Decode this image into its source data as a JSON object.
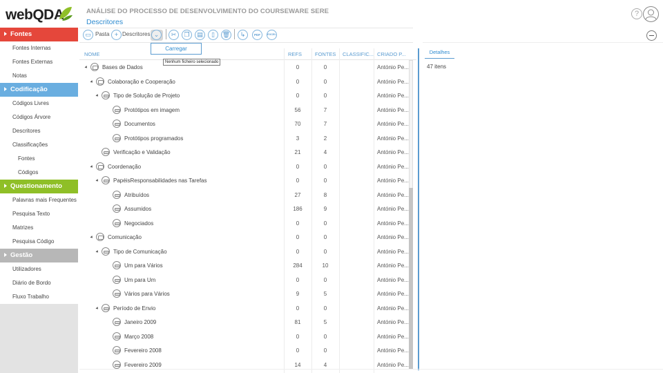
{
  "logo": {
    "text": "webQDA"
  },
  "nav": {
    "sections": [
      {
        "title": "Fontes",
        "color": "#e5473b",
        "items": [
          "Fontes Internas",
          "Fontes Externas",
          "Notas"
        ]
      },
      {
        "title": "Codificação",
        "color": "#6aaee0",
        "items": [
          "Códigos Livres",
          "Códigos Árvore",
          "Descritores",
          "Classificações",
          "Fontes",
          "Códigos"
        ]
      },
      {
        "title": "Questionamento",
        "color": "#8fbf27",
        "items": [
          "Palavras mais Frequentes",
          "Pesquisa Texto",
          "Matrizes",
          "Pesquisa Código"
        ]
      },
      {
        "title": "Gestão",
        "color": "#b7b7b7",
        "items": [
          "Utilizadores",
          "Diário de Bordo",
          "Fluxo Trabalho"
        ]
      }
    ]
  },
  "header": {
    "app_title": "ANÁLISE DO PROCESSO DE DESENVOLVIMENTO DO COURSEWARE SERE",
    "page_title": "Descritores",
    "help": "?"
  },
  "toolbar": {
    "pasta_label": "Pasta",
    "descritores_label": "Descritores",
    "pdf_label": "PDF",
    "excel_label": "EXCEL"
  },
  "dropdown": {
    "option": "Carregar",
    "tooltip": "Nenhum ficheiro selecionado"
  },
  "table": {
    "columns": [
      "NOME",
      "REFS",
      "FONTES",
      "CLASSIFIC...",
      "CRIADO P..."
    ],
    "rows": [
      {
        "name": "Bases de Dados",
        "level": 0,
        "type": "folder",
        "expanded": true,
        "refs": "0",
        "fontes": "0",
        "autor": "António Pe..."
      },
      {
        "name": "Colaboração e Cooperação",
        "level": 1,
        "type": "folder",
        "expanded": true,
        "refs": "0",
        "fontes": "0",
        "autor": "António Pe..."
      },
      {
        "name": "Tipo de Solução de Projeto",
        "level": 2,
        "type": "code",
        "expanded": true,
        "refs": "0",
        "fontes": "0",
        "autor": "António Pe..."
      },
      {
        "name": "Protótipos em imagem",
        "level": 3,
        "type": "code",
        "expanded": false,
        "refs": "56",
        "fontes": "7",
        "autor": "António Pe..."
      },
      {
        "name": "Documentos",
        "level": 3,
        "type": "code",
        "expanded": false,
        "refs": "70",
        "fontes": "7",
        "autor": "António Pe..."
      },
      {
        "name": "Protótipos programados",
        "level": 3,
        "type": "code",
        "expanded": false,
        "refs": "3",
        "fontes": "2",
        "autor": "António Pe..."
      },
      {
        "name": "Verificação e Validação",
        "level": 2,
        "type": "code",
        "expanded": false,
        "refs": "21",
        "fontes": "4",
        "autor": "António Pe..."
      },
      {
        "name": "Coordenação",
        "level": 1,
        "type": "folder",
        "expanded": true,
        "refs": "0",
        "fontes": "0",
        "autor": "António Pe..."
      },
      {
        "name": "PapéisResponsabilidades nas Tarefas",
        "level": 2,
        "type": "code",
        "expanded": true,
        "refs": "0",
        "fontes": "0",
        "autor": "António Pe..."
      },
      {
        "name": "Atribuídos",
        "level": 3,
        "type": "code",
        "expanded": false,
        "refs": "27",
        "fontes": "8",
        "autor": "António Pe..."
      },
      {
        "name": "Assumidos",
        "level": 3,
        "type": "code",
        "expanded": false,
        "refs": "186",
        "fontes": "9",
        "autor": "António Pe..."
      },
      {
        "name": "Negociados",
        "level": 3,
        "type": "code",
        "expanded": false,
        "refs": "0",
        "fontes": "0",
        "autor": "António Pe..."
      },
      {
        "name": "Comunicação",
        "level": 1,
        "type": "folder",
        "expanded": true,
        "refs": "0",
        "fontes": "0",
        "autor": "António Pe..."
      },
      {
        "name": "Tipo de Comunicação",
        "level": 2,
        "type": "code",
        "expanded": true,
        "refs": "0",
        "fontes": "0",
        "autor": "António Pe..."
      },
      {
        "name": "Um para Vários",
        "level": 3,
        "type": "code",
        "expanded": false,
        "refs": "284",
        "fontes": "10",
        "autor": "António Pe..."
      },
      {
        "name": "Um para Um",
        "level": 3,
        "type": "code",
        "expanded": false,
        "refs": "0",
        "fontes": "0",
        "autor": "António Pe..."
      },
      {
        "name": "Vários para Vários",
        "level": 3,
        "type": "code",
        "expanded": false,
        "refs": "9",
        "fontes": "5",
        "autor": "António Pe..."
      },
      {
        "name": "Período de Envio",
        "level": 2,
        "type": "code",
        "expanded": true,
        "refs": "0",
        "fontes": "0",
        "autor": "António Pe..."
      },
      {
        "name": "Janeiro 2009",
        "level": 3,
        "type": "code",
        "expanded": false,
        "refs": "81",
        "fontes": "5",
        "autor": "António Pe..."
      },
      {
        "name": "Março 2008",
        "level": 3,
        "type": "code",
        "expanded": false,
        "refs": "0",
        "fontes": "0",
        "autor": "António Pe..."
      },
      {
        "name": "Fevereiro 2008",
        "level": 3,
        "type": "code",
        "expanded": false,
        "refs": "0",
        "fontes": "0",
        "autor": "António Pe..."
      },
      {
        "name": "Fevereiro 2009",
        "level": 3,
        "type": "code",
        "expanded": false,
        "refs": "14",
        "fontes": "4",
        "autor": "António Pe..."
      }
    ]
  },
  "details": {
    "tab_label": "Detalhes",
    "count": "47 itens"
  }
}
